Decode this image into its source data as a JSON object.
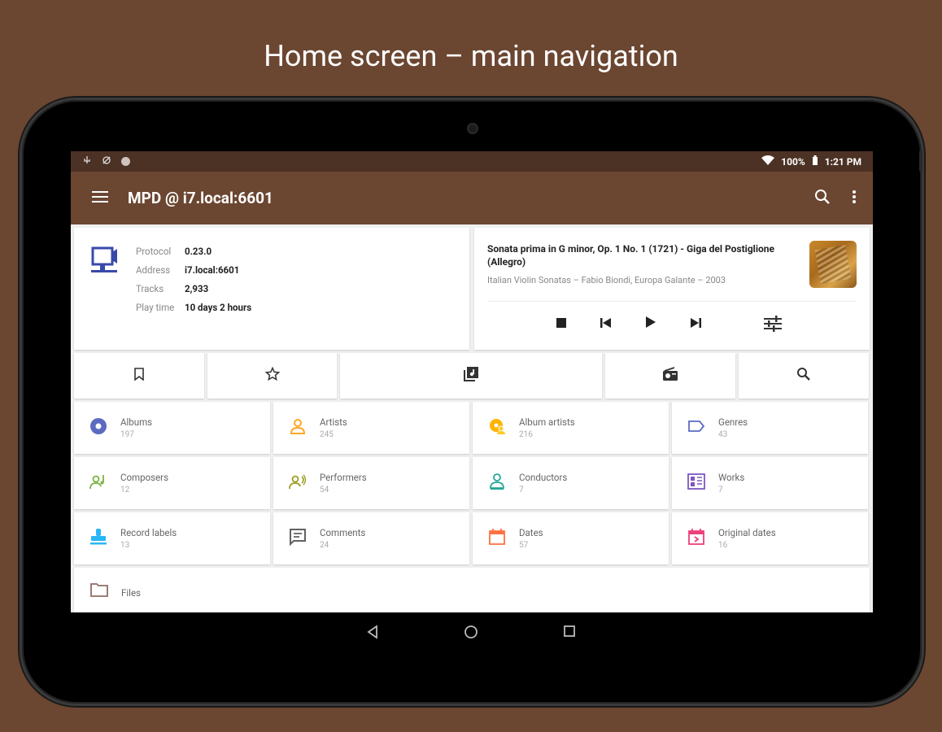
{
  "headline": "Home screen – main navigation",
  "status": {
    "battery": "100%",
    "time": "1:21 PM"
  },
  "toolbar": {
    "title": "MPD @ i7.local:6601"
  },
  "server": {
    "rows": [
      {
        "key": "Protocol",
        "value": "0.23.0"
      },
      {
        "key": "Address",
        "value": "i7.local:6601"
      },
      {
        "key": "Tracks",
        "value": "2,933"
      },
      {
        "key": "Play time",
        "value": "10 days 2 hours"
      }
    ]
  },
  "player": {
    "track": "Sonata prima in G minor, Op. 1 No. 1 (1721) - Giga del Postiglione (Allegro)",
    "subtitle": "Italian Violin Sonatas – Fabio Biondi, Europa Galante – 2003"
  },
  "tiles": [
    {
      "label": "Albums",
      "count": "197",
      "icon": "album-icon",
      "color": "#5c6bc0"
    },
    {
      "label": "Artists",
      "count": "245",
      "icon": "artist-icon",
      "color": "#ffa726"
    },
    {
      "label": "Album artists",
      "count": "216",
      "icon": "album-artist-icon",
      "color": "#ffb300"
    },
    {
      "label": "Genres",
      "count": "43",
      "icon": "label-icon",
      "color": "#5c6bc0"
    },
    {
      "label": "Composers",
      "count": "12",
      "icon": "composer-icon",
      "color": "#7cb342"
    },
    {
      "label": "Performers",
      "count": "54",
      "icon": "performer-icon",
      "color": "#9e9d24"
    },
    {
      "label": "Conductors",
      "count": "7",
      "icon": "conductor-icon",
      "color": "#26a69a"
    },
    {
      "label": "Works",
      "count": "7",
      "icon": "works-icon",
      "color": "#7e57c2"
    },
    {
      "label": "Record labels",
      "count": "13",
      "icon": "record-label-icon",
      "color": "#29b6f6"
    },
    {
      "label": "Comments",
      "count": "24",
      "icon": "comment-icon",
      "color": "#616161"
    },
    {
      "label": "Dates",
      "count": "57",
      "icon": "calendar-icon",
      "color": "#ff7043"
    },
    {
      "label": "Original dates",
      "count": "16",
      "icon": "calendar-arrow-icon",
      "color": "#ec407a"
    }
  ],
  "files": {
    "label": "Files"
  }
}
